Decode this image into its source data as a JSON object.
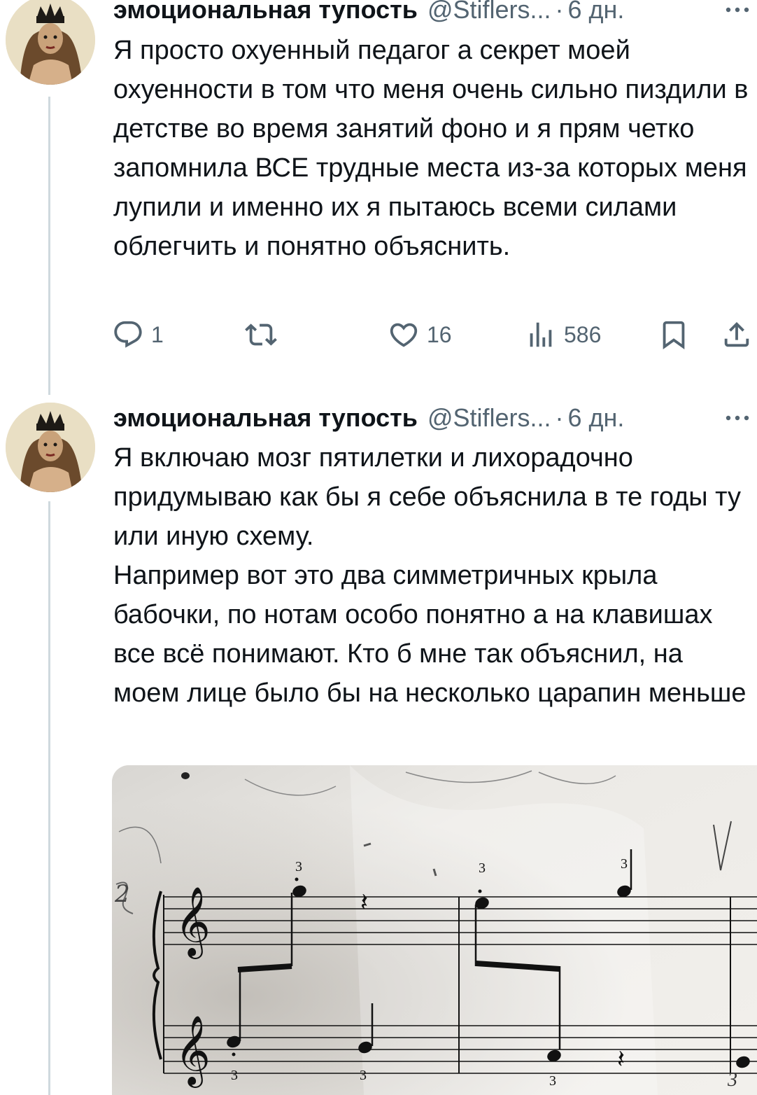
{
  "tweets": [
    {
      "author_name": "эмоциональная тупость",
      "handle": "@Stiflers...",
      "separator": "·",
      "time": "6 дн.",
      "text": "Я просто охуенный педагог а секрет моей охуенности в том что меня очень сильно пиздили в детстве во время занятий фоно и я прям четко запомнила ВСЕ трудные места из-за которых меня лупили и именно их я пытаюсь всеми силами облегчить и понятно объяснить.",
      "stats": {
        "replies": "1",
        "reposts": "",
        "likes": "16",
        "views": "586"
      }
    },
    {
      "author_name": "эмоциональная тупость",
      "handle": "@Stiflers...",
      "separator": "·",
      "time": "6 дн.",
      "text_lines": [
        "Я включаю мозг пятилетки и лихорадочно придумываю как бы я себе объяснила в те годы ту или иную схему.",
        "Например вот это два симметричных крыла бабочки, по нотам особо понятно а на клавишах все всё понимают. Кто б мне так объяснил, на моем лице было бы на несколько царапин меньше"
      ],
      "media": {
        "kind": "photo",
        "description_icon": "sheet-music-photo",
        "fingering_marks": [
          "3",
          "3",
          "3",
          "3",
          "3",
          "3",
          "3"
        ],
        "handwritten_marks": [
          "2",
          "V"
        ]
      }
    }
  ],
  "icons": {
    "reply": "reply-icon",
    "repost": "repost-icon",
    "like": "heart-icon",
    "views": "views-icon",
    "bookmark": "bookmark-icon",
    "share": "share-icon",
    "more": "more-icon"
  },
  "colors": {
    "text": "#0f1419",
    "secondary": "#536471",
    "thread_line": "#cfd9de"
  }
}
